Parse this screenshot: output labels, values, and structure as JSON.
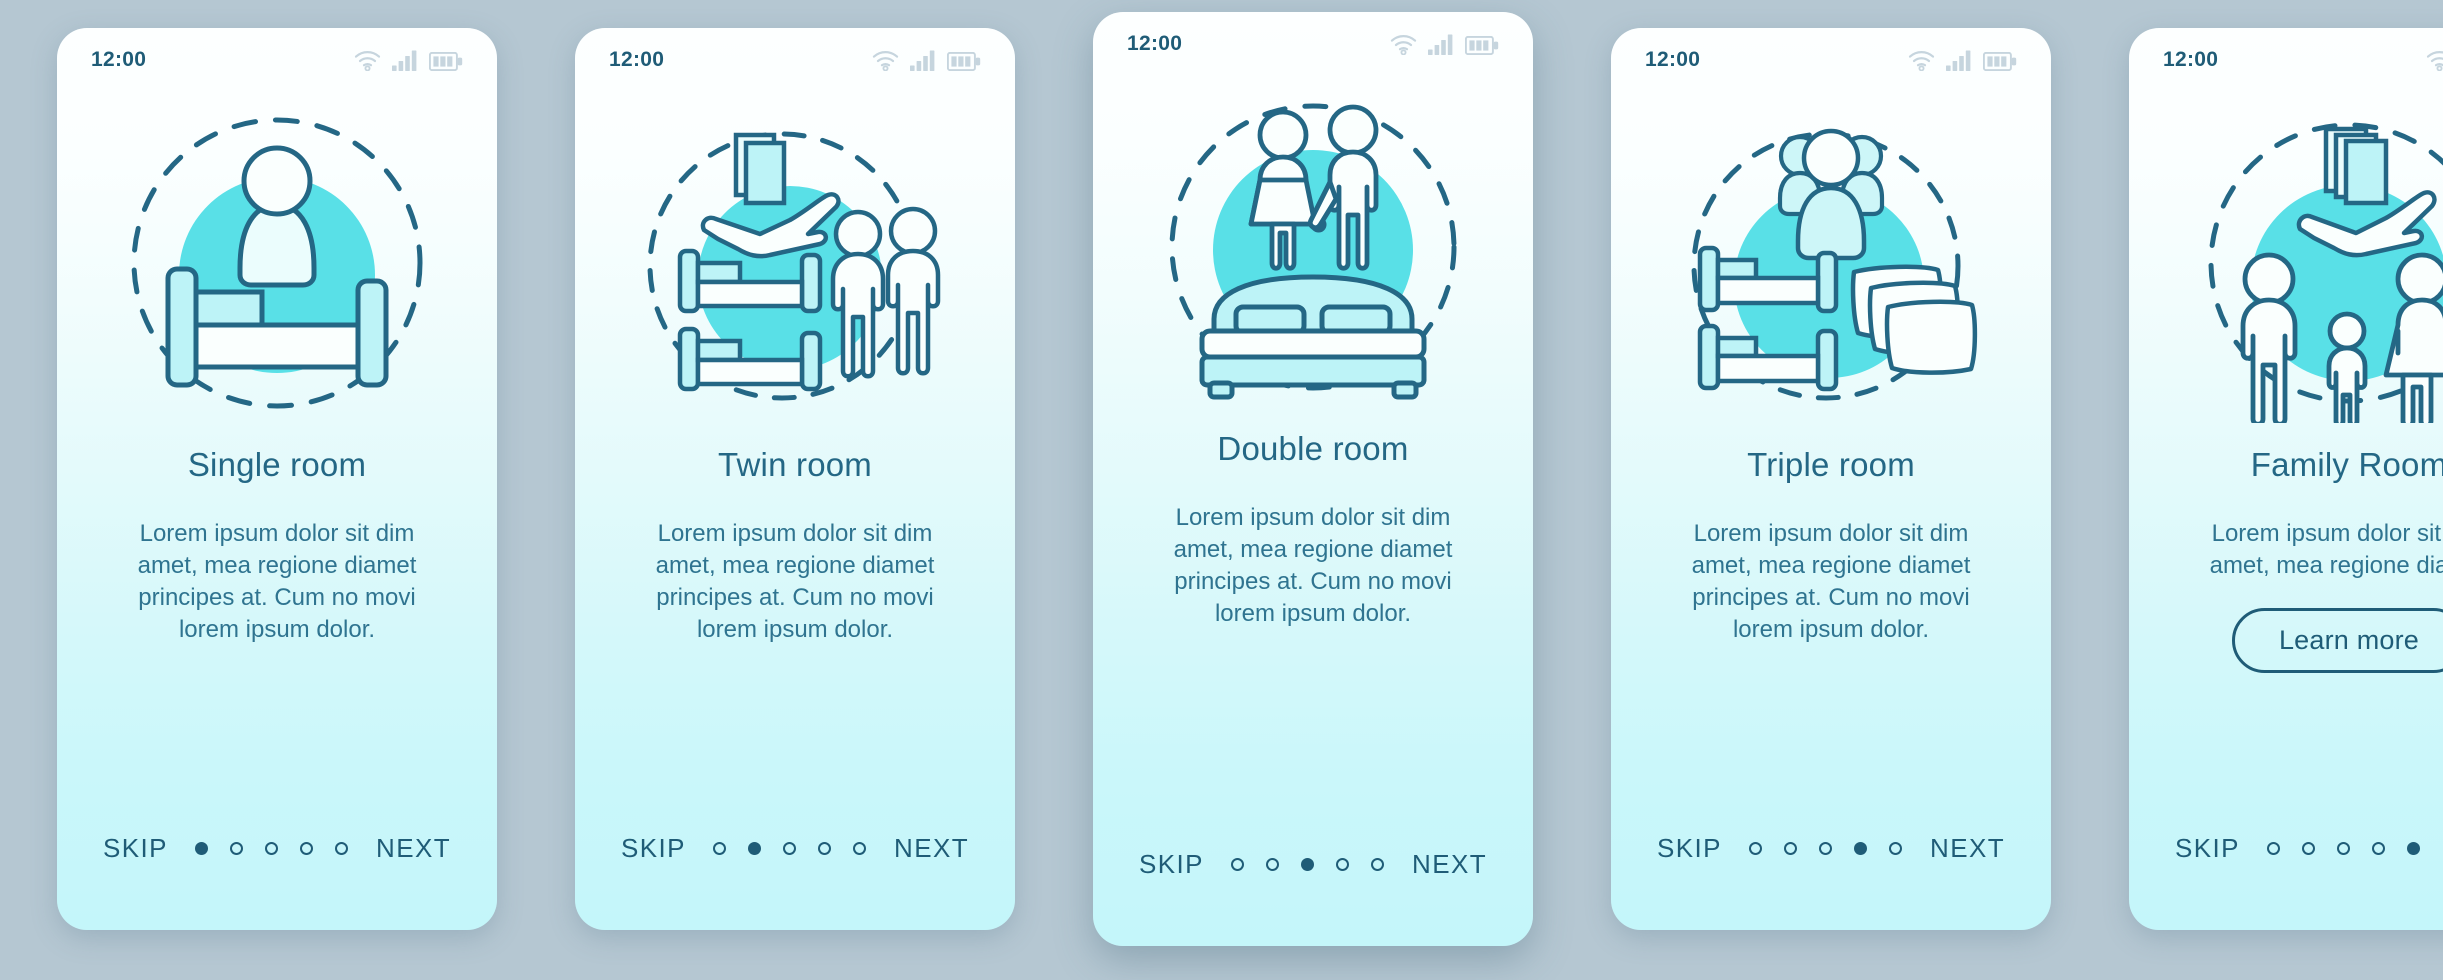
{
  "page": {
    "background_color": "#b5c7d2",
    "accent_color": "#4fe0e5",
    "line_color": "#246785",
    "text_color": "#2f7490"
  },
  "status_bar": {
    "time": "12:00",
    "wifi_icon": "wifi-icon",
    "signal_icon": "signal-bars-icon",
    "battery_icon": "battery-icon"
  },
  "footer": {
    "skip_label": "SKIP",
    "next_label": "NEXT",
    "dot_count": 5
  },
  "screens": [
    {
      "illustration": "single-bed-with-person-illustration",
      "title": "Single room",
      "body": "Lorem ipsum dolor sit dim amet, mea regione diamet principes at. Cum no movi lorem ipsum dolor.",
      "active_dot": 1,
      "cta_label": null
    },
    {
      "illustration": "twin-beds-with-two-people-illustration",
      "title": "Twin room",
      "body": "Lorem ipsum dolor sit dim amet, mea regione diamet principes at. Cum no movi lorem ipsum dolor.",
      "active_dot": 2,
      "cta_label": null
    },
    {
      "illustration": "double-bed-with-couple-illustration",
      "title": "Double room",
      "body": "Lorem ipsum dolor sit dim amet, mea regione diamet principes at. Cum no movi lorem ipsum dolor.",
      "active_dot": 3,
      "cta_label": null
    },
    {
      "illustration": "bunk-beds-with-group-and-pillows-illustration",
      "title": "Triple room",
      "body": "Lorem ipsum dolor sit dim amet, mea regione diamet principes at. Cum no movi lorem ipsum dolor.",
      "active_dot": 4,
      "cta_label": null
    },
    {
      "illustration": "family-with-hand-holding-cards-illustration",
      "title": "Family Room",
      "body": "Lorem ipsum dolor sit dim amet, mea regione diamet",
      "active_dot": 5,
      "cta_label": "Learn more"
    }
  ]
}
